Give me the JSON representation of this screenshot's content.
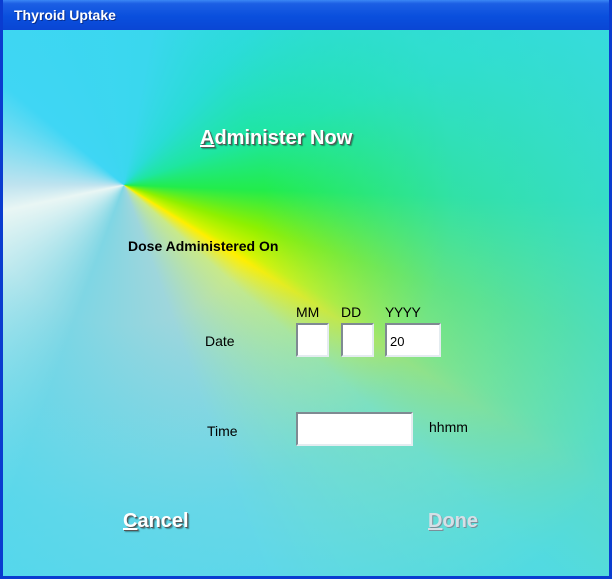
{
  "window": {
    "title": "Thyroid Uptake"
  },
  "actions": {
    "administer_now_prefix": "A",
    "administer_now_rest": "dminister Now",
    "cancel_prefix": "C",
    "cancel_rest": "ancel",
    "done_prefix": "D",
    "done_rest": "one",
    "done_enabled": false
  },
  "form": {
    "section_heading": "Dose Administered On",
    "date": {
      "label": "Date",
      "mm_header": "MM",
      "dd_header": "DD",
      "yyyy_header": "YYYY",
      "mm_value": "",
      "dd_value": "",
      "yyyy_value": "20"
    },
    "time": {
      "label": "Time",
      "value": "",
      "format_hint": "hhmm"
    }
  },
  "colors": {
    "title_bar": "#0a46d4",
    "accent_yellow": "#ffef00",
    "accent_cyan": "#3ad7ee"
  }
}
